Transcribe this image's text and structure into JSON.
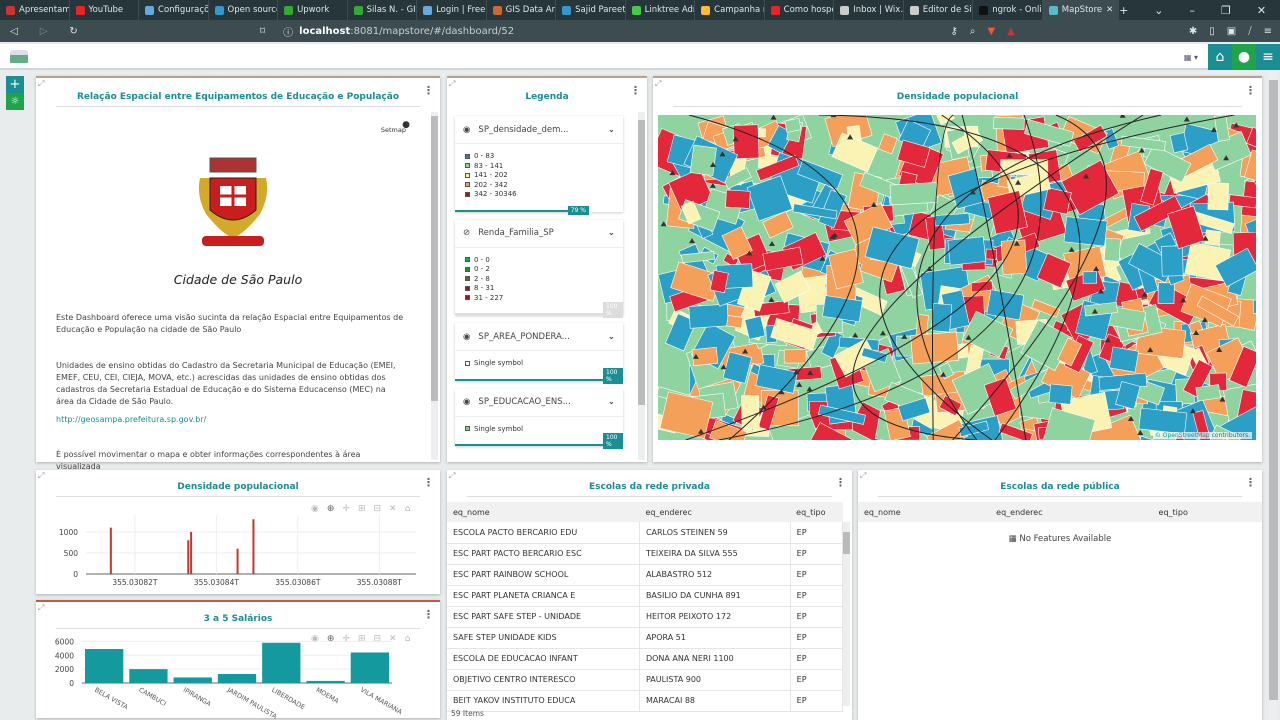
{
  "browser": {
    "tabs": [
      {
        "label": "Apresentam",
        "color": "#c33"
      },
      {
        "label": "YouTube",
        "color": "#e22"
      },
      {
        "label": "Configuraçõ",
        "color": "#6ad"
      },
      {
        "label": "Open source",
        "color": "#39c"
      },
      {
        "label": "Upwork",
        "color": "#3a3"
      },
      {
        "label": "Silas N. - GIS",
        "color": "#3a3"
      },
      {
        "label": "Login | Freel",
        "color": "#6ad"
      },
      {
        "label": "GIS Data An",
        "color": "#c63"
      },
      {
        "label": "Sajid Pareeth",
        "color": "#39c"
      },
      {
        "label": "Linktree Adm",
        "color": "#4c4"
      },
      {
        "label": "Campanha n",
        "color": "#fb3"
      },
      {
        "label": "Como hospe",
        "color": "#e22"
      },
      {
        "label": "Inbox | Wix.c",
        "color": "#ccc"
      },
      {
        "label": "Editor de Sit",
        "color": "#ccc"
      },
      {
        "label": "ngrok - Onli",
        "color": "#111"
      },
      {
        "label": "MapStore",
        "color": "#5bc"
      }
    ],
    "url_host": "localhost",
    "url_rest": ":8081/mapstore/#/dashboard/52"
  },
  "colors": {
    "accent": "#1b8e94",
    "green": "#1ea44a",
    "map": [
      "#2c9fc7",
      "#8fd3a0",
      "#fbf3b4",
      "#f5a05a",
      "#e3283c"
    ]
  },
  "text_panel": {
    "title": "Relação Espacial entre Equipamentos de Educação e População",
    "setmap": "Setmap",
    "city": "Cidade de São Paulo",
    "para1": "Este Dashboard oferece uma visão sucinta da relação Espacial entre Equipamentos de Educação e População na cidade de São Paulo",
    "para2": "Unidades de ensino obtidas do Cadastro da Secretaria Municipal de Educação (EMEI, EMEF, CEU, CEI, CIEJA, MOVA, etc.) acrescidas das unidades de ensino obtidas dos cadastros da Secretaria Estadual de Educação e do Sistema Educacenso (MEC) na área da Cidade de São Paulo.",
    "link": "http://geosampa.prefeitura.sp.gov.br/",
    "para3": "É possível movimentar o mapa e obter informações correspondentes à área visualizada"
  },
  "legend": {
    "title": "Legenda",
    "layers": [
      {
        "name": "SP_densidade_dem...",
        "visible": true,
        "opacity": "79 %",
        "items": [
          {
            "label": "0 - 83",
            "color": "#2c7fb8"
          },
          {
            "label": "83 - 141",
            "color": "#8fd3a0"
          },
          {
            "label": "141 - 202",
            "color": "#fbf3b4"
          },
          {
            "label": "202 - 342",
            "color": "#f5a05a"
          },
          {
            "label": "342 - 30346",
            "color": "#b01020"
          }
        ]
      },
      {
        "name": "Renda_Familia_SP",
        "visible": false,
        "opacity": "100 %",
        "items": [
          {
            "label": "0 - 0",
            "color": "#1ea44a"
          },
          {
            "label": "0 - 2",
            "color": "#2a8a30"
          },
          {
            "label": "2 - 8",
            "color": "#556b2f"
          },
          {
            "label": "8 - 31",
            "color": "#7a2a20"
          },
          {
            "label": "31 - 227",
            "color": "#a01020"
          }
        ]
      },
      {
        "name": "SP_AREA_PONDERA...",
        "visible": true,
        "opacity": "100 %",
        "items": [
          {
            "label": "Single symbol",
            "color": "#ffffff"
          }
        ]
      },
      {
        "name": "SP_EDUCACAO_ENS...",
        "visible": true,
        "opacity": "100 %",
        "items": [
          {
            "label": "Single symbol",
            "color": "#6ee07a"
          }
        ]
      }
    ]
  },
  "map": {
    "title": "Densidade populacional",
    "attribution_link": "© OpenStreetMap",
    "attribution_rest": " contributors."
  },
  "chart_data": [
    {
      "type": "bar",
      "title": "Densidade populacional",
      "x": [
        355.0308141,
        355.0308331,
        355.0308338,
        355.0308452,
        355.0308491
      ],
      "values": [
        1100,
        800,
        1000,
        600,
        1300
      ],
      "xticks": [
        "355.03082T",
        "355.03084T",
        "355.03086T",
        "355.03088T"
      ],
      "xtick_values": [
        355.03082,
        355.03084,
        355.03086,
        355.03088
      ],
      "xlim": [
        355.030808,
        355.030889
      ],
      "yticks": [
        "0",
        "500",
        "1000"
      ],
      "ylim": [
        0,
        1400
      ],
      "color": "#c0392b"
    },
    {
      "type": "bar",
      "title": "3 a 5 Salários",
      "categories": [
        "BELA VISTA",
        "CAMBUCI",
        "IPIRANGA",
        "JARDIM PAULISTA",
        "LIBERDADE",
        "MOEMA",
        "VILA MARIANA"
      ],
      "values": [
        4900,
        2000,
        800,
        1300,
        5800,
        300,
        4400
      ],
      "yticks": [
        "0",
        "2000",
        "4000",
        "6000"
      ],
      "ylim": [
        0,
        6200
      ],
      "color": "#14999e"
    }
  ],
  "private_table": {
    "title": "Escolas da rede privada",
    "columns": [
      "eq_nome",
      "eq_enderec",
      "eq_tipo"
    ],
    "rows": [
      [
        "ESCOLA PACTO BERCARIO EDU",
        "CARLOS STEINEN 59",
        "EP"
      ],
      [
        "ESC PART PACTO BERCARIO ESC",
        "TEIXEIRA DA SILVA 555",
        "EP"
      ],
      [
        "ESC PART RAINBOW SCHOOL",
        "ALABASTRO 512",
        "EP"
      ],
      [
        "ESC PART PLANETA CRIANCA E",
        "BASILIO DA CUNHA 891",
        "EP"
      ],
      [
        "ESC PART SAFE STEP - UNIDADE",
        "HEITOR PEIXOTO 172",
        "EP"
      ],
      [
        "SAFE STEP UNIDADE KIDS",
        "APORA 51",
        "EP"
      ],
      [
        "ESCOLA DE EDUCACAO INFANT",
        "DONA ANA NERI 1100",
        "EP"
      ],
      [
        "OBJETIVO CENTRO INTERESCO",
        "PAULISTA 900",
        "EP"
      ],
      [
        "BEIT YAKOV INSTITUTO EDUCA",
        "MARACAI 88",
        "EP"
      ]
    ],
    "count": "59 Items"
  },
  "public_table": {
    "title": "Escolas da rede pública",
    "columns": [
      "eq_nome",
      "eq_enderec",
      "eq_tipo"
    ],
    "empty": "No Features Available"
  }
}
